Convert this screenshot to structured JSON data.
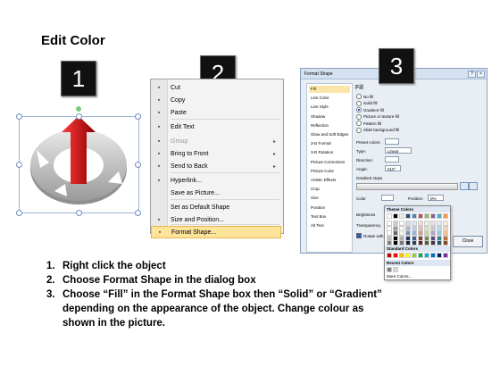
{
  "page_title": "Edit Color",
  "badges": [
    "1",
    "2",
    "3"
  ],
  "context_menu": {
    "items": [
      {
        "label": "Cut",
        "icon": "scissors-icon",
        "disabled": false,
        "arrow": false
      },
      {
        "label": "Copy",
        "icon": "copy-icon",
        "disabled": false,
        "arrow": false
      },
      {
        "label": "Paste",
        "icon": "paste-icon",
        "disabled": false,
        "arrow": false
      },
      {
        "label": "Edit Text",
        "icon": "edit-text-icon",
        "disabled": false,
        "arrow": false
      },
      {
        "label": "Group",
        "icon": "group-icon",
        "disabled": true,
        "arrow": true
      },
      {
        "label": "Bring to Front",
        "icon": "bring-front-icon",
        "disabled": false,
        "arrow": true
      },
      {
        "label": "Send to Back",
        "icon": "send-back-icon",
        "disabled": false,
        "arrow": true
      },
      {
        "label": "Hyperlink...",
        "icon": "hyperlink-icon",
        "disabled": false,
        "arrow": false
      },
      {
        "label": "Save as Picture...",
        "icon": "",
        "disabled": false,
        "arrow": false
      },
      {
        "label": "Set as Default Shape",
        "icon": "",
        "disabled": false,
        "arrow": false
      },
      {
        "label": "Size and Position...",
        "icon": "size-icon",
        "disabled": false,
        "arrow": false
      },
      {
        "label": "Format Shape...",
        "icon": "format-shape-icon",
        "disabled": false,
        "arrow": false,
        "highlighted": true
      }
    ]
  },
  "dialog": {
    "title": "Format Shape",
    "nav": [
      "Fill",
      "Line Color",
      "Line Style",
      "Shadow",
      "Reflection",
      "Glow and Soft Edges",
      "3-D Format",
      "3-D Rotation",
      "Picture Corrections",
      "Picture Color",
      "Artistic Effects",
      "Crop",
      "Size",
      "Position",
      "Text Box",
      "Alt Text"
    ],
    "nav_selected": 0,
    "section": "Fill",
    "fill_options": [
      "No fill",
      "Solid fill",
      "Gradient fill",
      "Picture or texture fill",
      "Pattern fill",
      "Slide background fill"
    ],
    "fill_selected": 2,
    "preset_colors_label": "Preset colors:",
    "type_label": "Type:",
    "type_value": "Linear",
    "direction_label": "Direction:",
    "angle_label": "Angle:",
    "angle_value": "210°",
    "gradient_stops_label": "Gradient stops",
    "color_label": "Color",
    "position_label": "Position:",
    "position_value": "0%",
    "brightness_label": "Brightness",
    "transparency_label": "Transparency",
    "rotate_label": "Rotate with shape",
    "close_label": "Close"
  },
  "color_popup": {
    "theme_header": "Theme Colors",
    "standard_header": "Standard Colors",
    "recent_header": "Recent Colors",
    "more_colors": "More Colors...",
    "theme_top": [
      "#ffffff",
      "#000000",
      "#eeece1",
      "#1f497d",
      "#4f81bd",
      "#c0504d",
      "#9bbb59",
      "#8064a2",
      "#4bacc6",
      "#f79646"
    ],
    "standard": [
      "#c00000",
      "#ff0000",
      "#ffc000",
      "#ffff00",
      "#92d050",
      "#00b050",
      "#00b0f0",
      "#0070c0",
      "#002060",
      "#7030a0"
    ],
    "recent": [
      "#7f7f7f",
      "#d8d8d8"
    ]
  },
  "instructions": [
    {
      "num": "1.",
      "text": "Right click the object"
    },
    {
      "num": "2.",
      "text": "Choose Format Shape in the dialog box"
    },
    {
      "num": "3.",
      "text": "Choose “Fill” in the Format Shape box then “Solid” or “Gradient”"
    },
    {
      "num": "",
      "text": "depending on the appearance of the object. Change colour as"
    },
    {
      "num": "",
      "text": "shown in the picture."
    }
  ]
}
